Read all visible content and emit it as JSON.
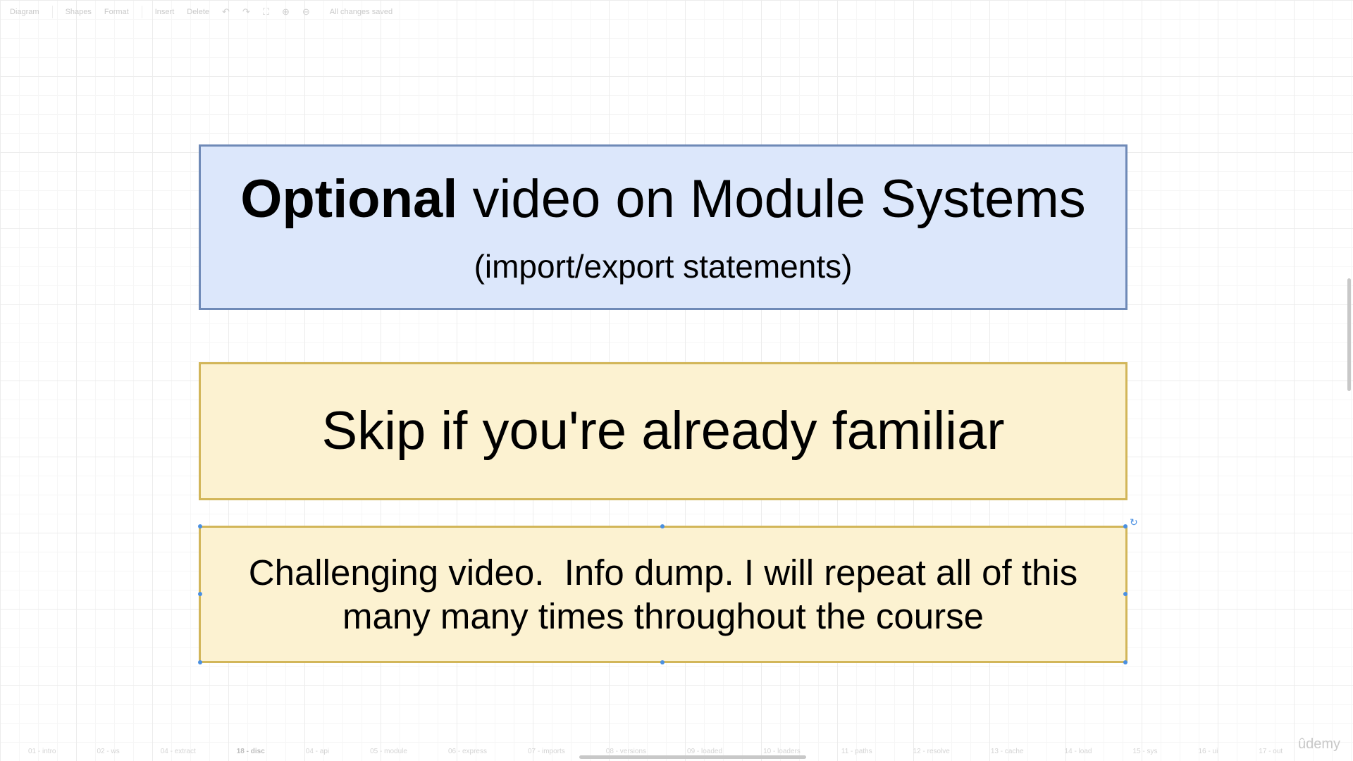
{
  "toolbar": {
    "diagram_menu": "Diagram",
    "shapes": "Shapes",
    "format": "Format",
    "insert": "Insert",
    "delete": "Delete",
    "status": "All changes saved"
  },
  "canvas": {
    "box1": {
      "title_bold": "Optional",
      "title_rest": " video on Module Systems",
      "subtitle": "(import/export statements)"
    },
    "box2": {
      "text": "Skip if you're already familiar"
    },
    "box3": {
      "line1": "Challenging video.  Info dump. I will repeat all of this",
      "line2": "many many times throughout the course"
    }
  },
  "pages": {
    "tabs": [
      "01 - intro",
      "02 - ws",
      "04 - extract",
      "18 - disc",
      "04 - api",
      "05 - module",
      "06 - express",
      "07 - imports",
      "08 - versions",
      "09 - loaded",
      "10 - loaders",
      "11 - paths",
      "12 - resolve",
      "13 - cache",
      "14 - load",
      "15 - sys",
      "16 - ui",
      "17 - out"
    ],
    "active_index": 3
  },
  "watermark": "ûdemy",
  "colors": {
    "blue_fill": "#dce7fb",
    "blue_border": "#6f8ab7",
    "yellow_fill": "#fcf2d1",
    "yellow_border": "#d2b659",
    "selection": "#4a90e2"
  }
}
